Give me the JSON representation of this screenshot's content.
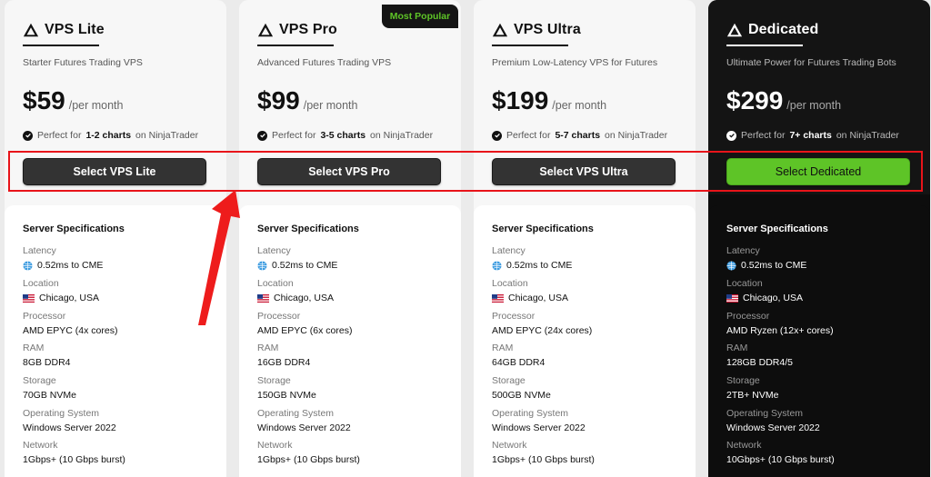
{
  "badge": "Most Popular",
  "specs_title": "Server Specifications",
  "labels": {
    "latency": "Latency",
    "location": "Location",
    "processor": "Processor",
    "ram": "RAM",
    "storage": "Storage",
    "os": "Operating System",
    "network": "Network"
  },
  "plans": [
    {
      "name": "VPS Lite",
      "desc": "Starter Futures Trading VPS",
      "price": "$59",
      "per": "/per month",
      "perfect_pre": "Perfect for",
      "perfect_bold": "1-2 charts",
      "perfect_post": "on NinjaTrader",
      "button": "Select VPS Lite",
      "latency": "0.52ms to CME",
      "location": "Chicago, USA",
      "processor": "AMD EPYC (4x cores)",
      "ram": "8GB DDR4",
      "storage": "70GB NVMe",
      "os": "Windows Server 2022",
      "network": "1Gbps+ (10 Gbps burst)"
    },
    {
      "name": "VPS Pro",
      "desc": "Advanced Futures Trading VPS",
      "price": "$99",
      "per": "/per month",
      "perfect_pre": "Perfect for",
      "perfect_bold": "3-5 charts",
      "perfect_post": "on NinjaTrader",
      "button": "Select VPS Pro",
      "latency": "0.52ms to CME",
      "location": "Chicago, USA",
      "processor": "AMD EPYC (6x cores)",
      "ram": "16GB DDR4",
      "storage": "150GB NVMe",
      "os": "Windows Server 2022",
      "network": "1Gbps+ (10 Gbps burst)"
    },
    {
      "name": "VPS Ultra",
      "desc": "Premium Low-Latency VPS for Futures",
      "price": "$199",
      "per": "/per month",
      "perfect_pre": "Perfect for",
      "perfect_bold": "5-7 charts",
      "perfect_post": "on NinjaTrader",
      "button": "Select VPS Ultra",
      "latency": "0.52ms to CME",
      "location": "Chicago, USA",
      "processor": "AMD EPYC (24x cores)",
      "ram": "64GB DDR4",
      "storage": "500GB NVMe",
      "os": "Windows Server 2022",
      "network": "1Gbps+ (10 Gbps burst)"
    },
    {
      "name": "Dedicated",
      "desc": "Ultimate Power for Futures Trading Bots",
      "price": "$299",
      "per": "/per month",
      "perfect_pre": "Perfect for",
      "perfect_bold": "7+ charts",
      "perfect_post": "on NinjaTrader",
      "button": "Select Dedicated",
      "latency": "0.52ms to CME",
      "location": "Chicago, USA",
      "processor": "AMD Ryzen (12x+ cores)",
      "ram": "128GB DDR4/5",
      "storage": "2TB+ NVMe",
      "os": "Windows Server 2022",
      "network": "10Gbps+ (10 Gbps burst)"
    }
  ],
  "colors": {
    "accent_green": "#5ec427",
    "annotation_red": "#e8141a",
    "dark_card": "#0d0d0d"
  }
}
